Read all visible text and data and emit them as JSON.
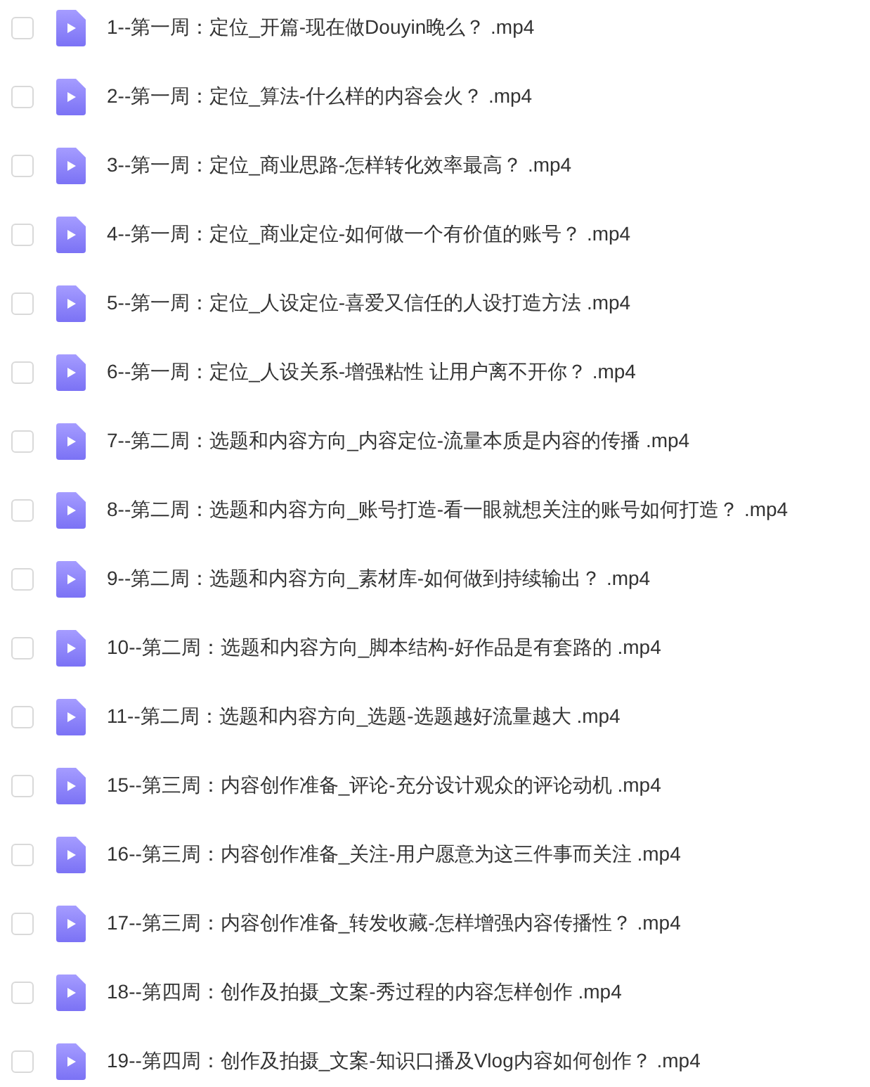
{
  "files": [
    {
      "name": "1--第一周：定位_开篇-现在做Douyin晚么？ .mp4",
      "checked": false
    },
    {
      "name": "2--第一周：定位_算法-什么样的内容会火？ .mp4",
      "checked": false
    },
    {
      "name": "3--第一周：定位_商业思路-怎样转化效率最高？ .mp4",
      "checked": false
    },
    {
      "name": "4--第一周：定位_商业定位-如何做一个有价值的账号？ .mp4",
      "checked": false
    },
    {
      "name": "5--第一周：定位_人设定位-喜爱又信任的人设打造方法 .mp4",
      "checked": false
    },
    {
      "name": "6--第一周：定位_人设关系-增强粘性 让用户离不开你？ .mp4",
      "checked": false
    },
    {
      "name": "7--第二周：选题和内容方向_内容定位-流量本质是内容的传播 .mp4",
      "checked": false
    },
    {
      "name": "8--第二周：选题和内容方向_账号打造-看一眼就想关注的账号如何打造？ .mp4",
      "checked": false
    },
    {
      "name": "9--第二周：选题和内容方向_素材库-如何做到持续输出？ .mp4",
      "checked": false
    },
    {
      "name": "10--第二周：选题和内容方向_脚本结构-好作品是有套路的 .mp4",
      "checked": false
    },
    {
      "name": "11--第二周：选题和内容方向_选题-选题越好流量越大 .mp4",
      "checked": false
    },
    {
      "name": "15--第三周：内容创作准备_评论-充分设计观众的评论动机 .mp4",
      "checked": false
    },
    {
      "name": "16--第三周：内容创作准备_关注-用户愿意为这三件事而关注 .mp4",
      "checked": false
    },
    {
      "name": "17--第三周：内容创作准备_转发收藏-怎样增强内容传播性？ .mp4",
      "checked": false
    },
    {
      "name": "18--第四周：创作及拍摄_文案-秀过程的内容怎样创作 .mp4",
      "checked": false
    },
    {
      "name": "19--第四周：创作及拍摄_文案-知识口播及Vlog内容如何创作？ .mp4",
      "checked": false
    }
  ]
}
